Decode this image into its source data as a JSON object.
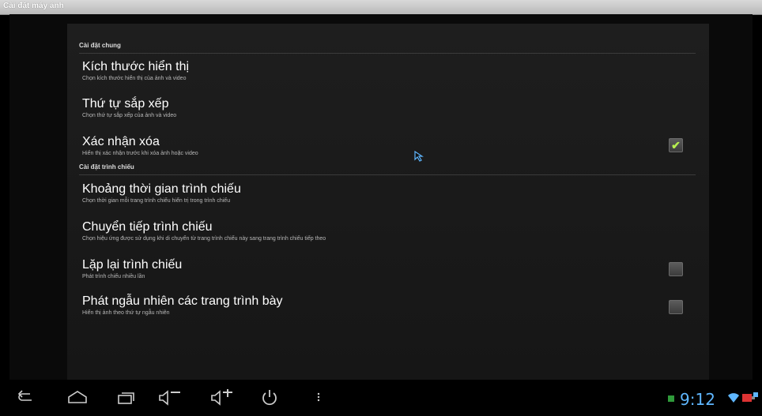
{
  "window": {
    "title": "Cài đặt máy ảnh"
  },
  "settings": {
    "general_header": "Cài đặt chung",
    "slideshow_header": "Cài đặt trình chiếu",
    "items": [
      {
        "title": "Kích thước hiển thị",
        "subtitle": "Chọn kích thước hiển thị của ảnh và video"
      },
      {
        "title": "Thứ tự sắp xếp",
        "subtitle": "Chọn thứ tự sắp xếp của ảnh và video"
      },
      {
        "title": "Xác nhận xóa",
        "subtitle": "Hiển thị xác nhận trước khi xóa ảnh hoặc video",
        "checked": true
      },
      {
        "title": "Khoảng thời gian trình chiếu",
        "subtitle": "Chọn thời gian mỗi trang trình chiếu hiển trị trong trình chiếu"
      },
      {
        "title": "Chuyển tiếp trình chiếu",
        "subtitle": "Chọn hiệu ứng được sử dụng khi di chuyển từ trang trình chiếu này sang trang trình chiếu tiếp theo"
      },
      {
        "title": "Lặp lại trình chiếu",
        "subtitle": "Phát trình chiếu nhiều lần",
        "checked": false
      },
      {
        "title": "Phát ngẫu nhiên các trang trình bày",
        "subtitle": "Hiển thị ảnh theo thứ tự ngẫu nhiên",
        "checked": false
      }
    ]
  },
  "statusbar": {
    "time": "9:12"
  },
  "colors": {
    "accent": "#5fb7ff",
    "check": "#b7f04f"
  },
  "icons": [
    "back-icon",
    "home-icon",
    "recent-apps-icon",
    "volume-down-icon",
    "volume-up-icon",
    "power-icon",
    "menu-icon",
    "wifi-icon",
    "battery-icon"
  ]
}
